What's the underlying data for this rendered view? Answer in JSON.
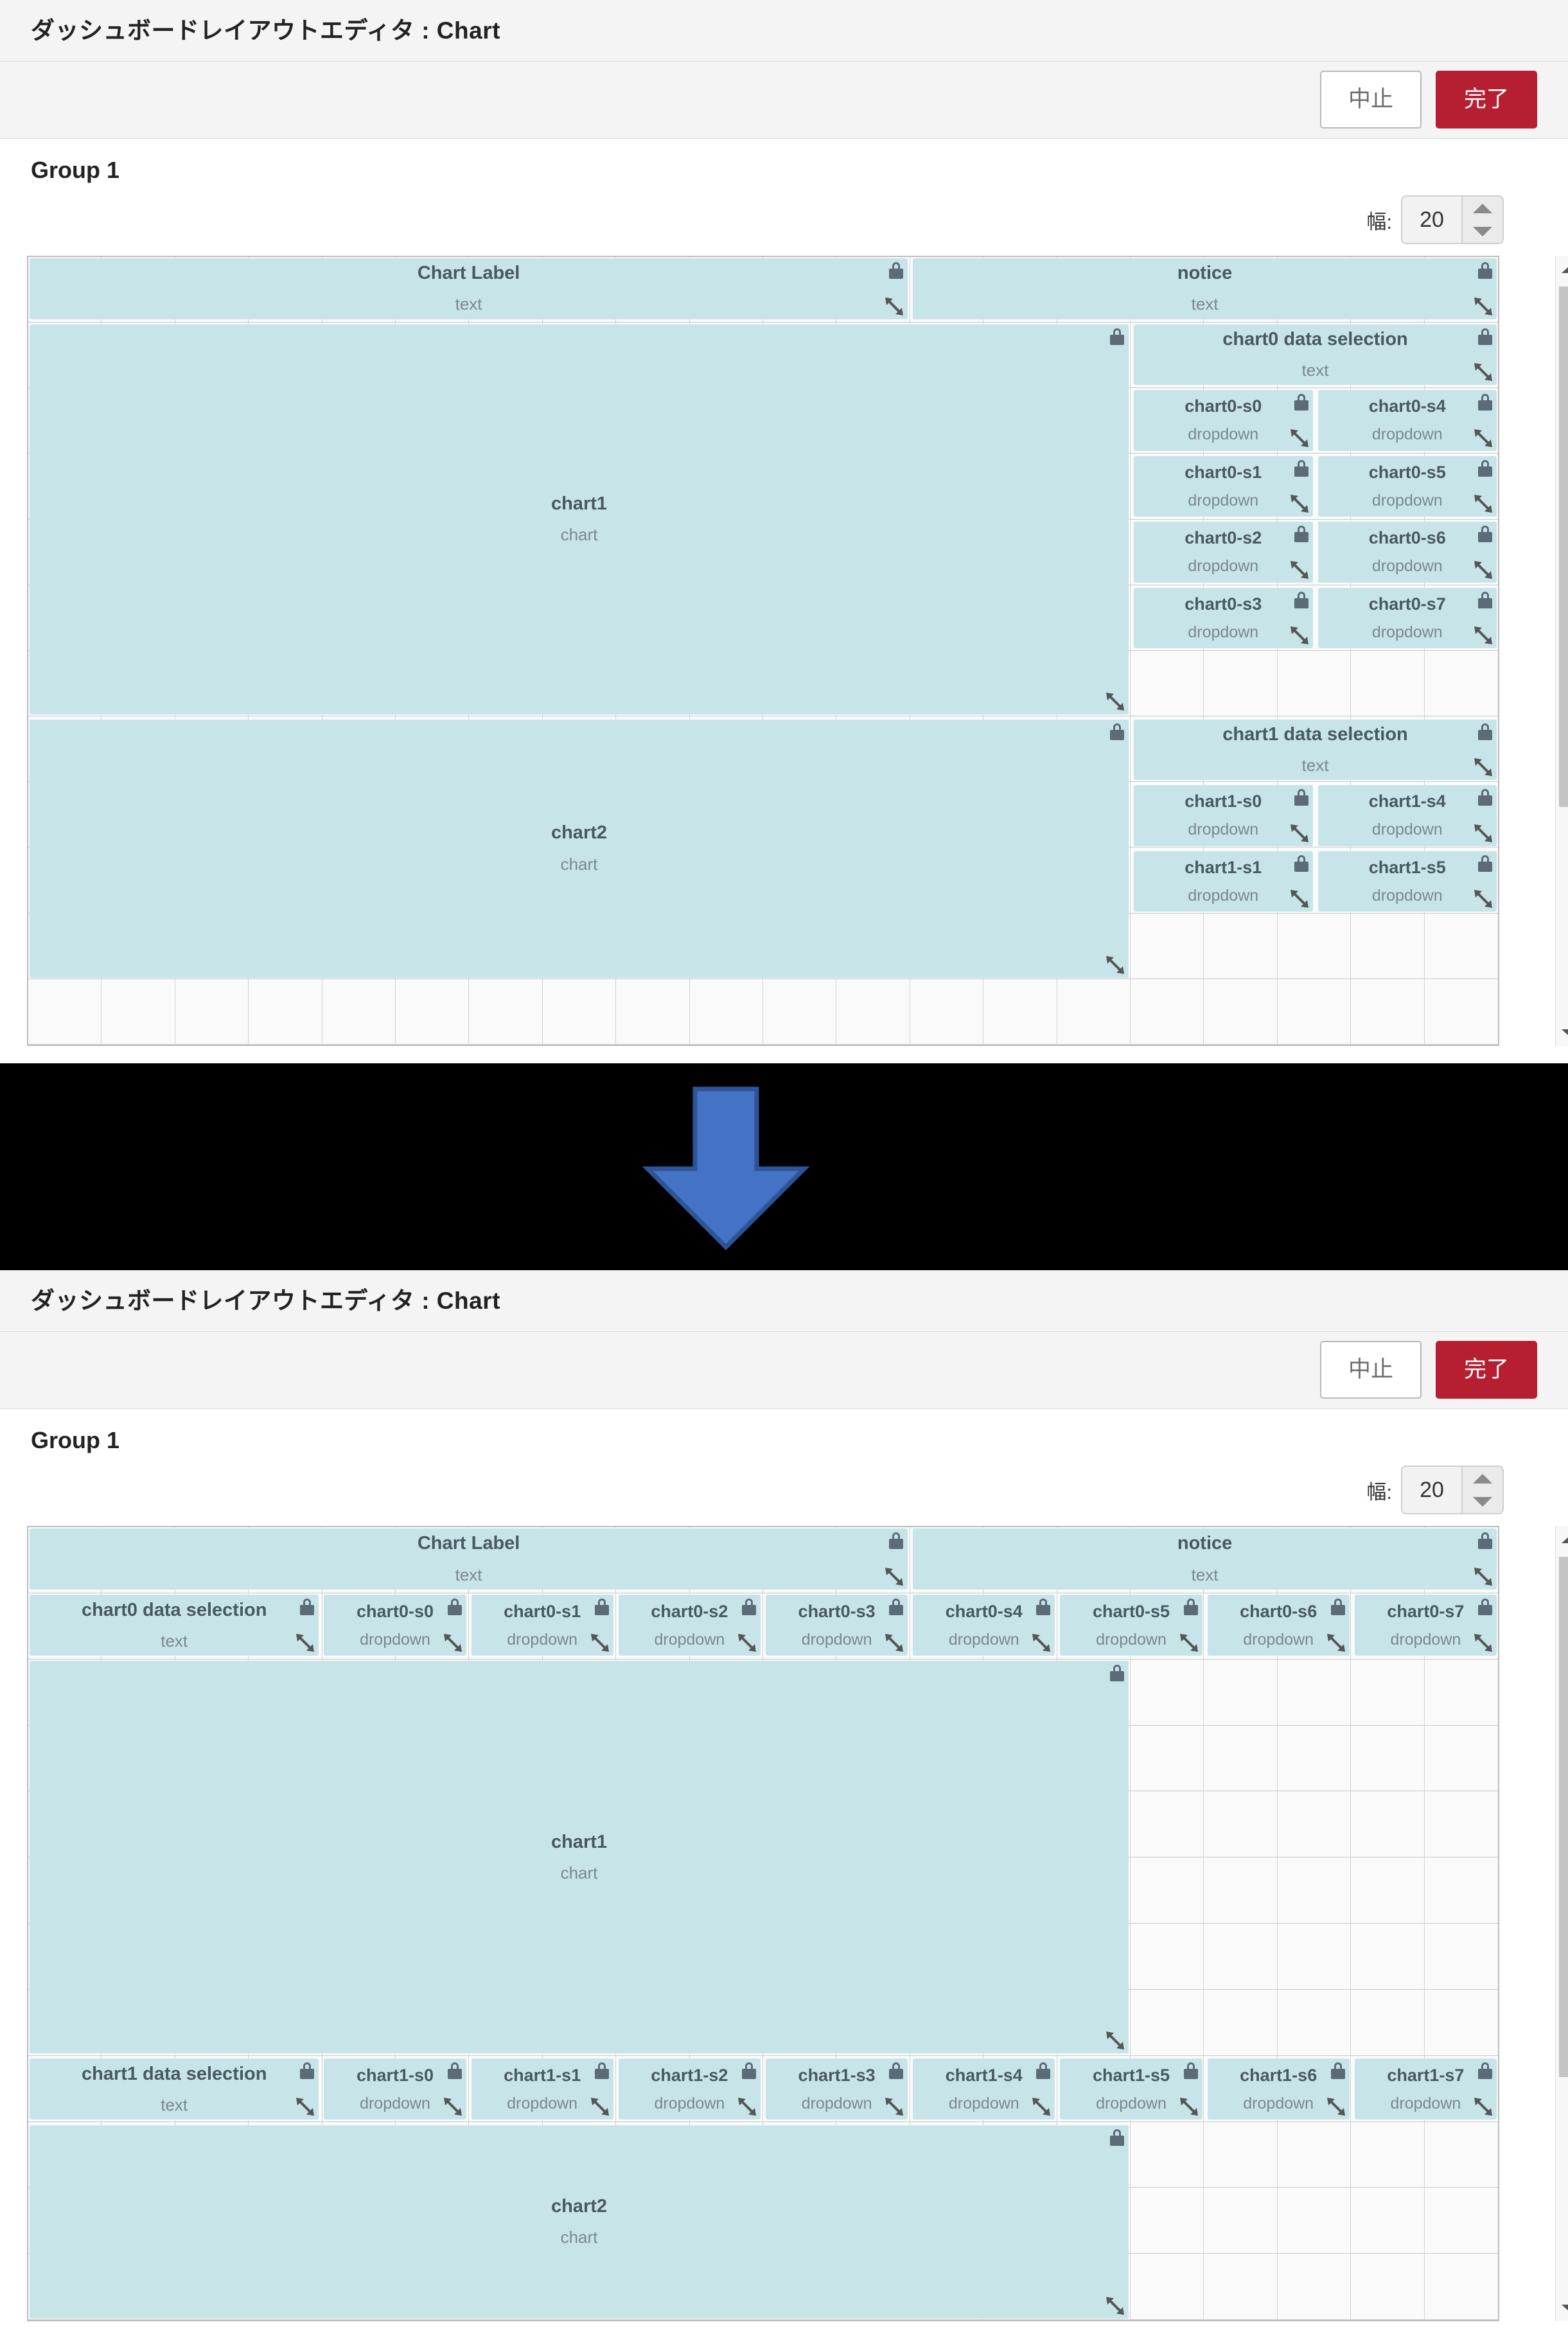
{
  "window": {
    "title": "ダッシュボードレイアウトエディタ : Chart",
    "cancel_label": "中止",
    "done_label": "完了"
  },
  "group": {
    "title": "Group 1"
  },
  "width_control": {
    "label": "幅:",
    "value": "20"
  },
  "colors": {
    "widget_fill": "#c7e5e9",
    "done_button": "#b61f31",
    "arrow": "#4472c4",
    "grid_line": "#d4d4d4"
  },
  "icons": {
    "lock": "lock-icon",
    "resize": "resize-handle-icon",
    "arrow_up": "chevron-up-icon",
    "arrow_down": "chevron-down-icon",
    "transform": "down-arrow-icon"
  },
  "before": {
    "widgets": [
      {
        "title": "Chart Label",
        "type": "text"
      },
      {
        "title": "notice",
        "type": "text"
      },
      {
        "title": "chart1",
        "type": "chart"
      },
      {
        "title": "chart0 data selection",
        "type": "text"
      },
      {
        "title": "chart0-s0",
        "type": "dropdown"
      },
      {
        "title": "chart0-s4",
        "type": "dropdown"
      },
      {
        "title": "chart0-s1",
        "type": "dropdown"
      },
      {
        "title": "chart0-s5",
        "type": "dropdown"
      },
      {
        "title": "chart0-s2",
        "type": "dropdown"
      },
      {
        "title": "chart0-s6",
        "type": "dropdown"
      },
      {
        "title": "chart0-s3",
        "type": "dropdown"
      },
      {
        "title": "chart0-s7",
        "type": "dropdown"
      },
      {
        "title": "chart2",
        "type": "chart"
      },
      {
        "title": "chart1 data selection",
        "type": "text"
      },
      {
        "title": "chart1-s0",
        "type": "dropdown"
      },
      {
        "title": "chart1-s4",
        "type": "dropdown"
      },
      {
        "title": "chart1-s1",
        "type": "dropdown"
      },
      {
        "title": "chart1-s5",
        "type": "dropdown"
      }
    ]
  },
  "after": {
    "widgets": [
      {
        "title": "Chart Label",
        "type": "text"
      },
      {
        "title": "notice",
        "type": "text"
      },
      {
        "title": "chart0 data selection",
        "type": "text"
      },
      {
        "title": "chart0-s0",
        "type": "dropdown"
      },
      {
        "title": "chart0-s1",
        "type": "dropdown"
      },
      {
        "title": "chart0-s2",
        "type": "dropdown"
      },
      {
        "title": "chart0-s3",
        "type": "dropdown"
      },
      {
        "title": "chart0-s4",
        "type": "dropdown"
      },
      {
        "title": "chart0-s5",
        "type": "dropdown"
      },
      {
        "title": "chart0-s6",
        "type": "dropdown"
      },
      {
        "title": "chart0-s7",
        "type": "dropdown"
      },
      {
        "title": "chart1",
        "type": "chart"
      },
      {
        "title": "chart1 data selection",
        "type": "text"
      },
      {
        "title": "chart1-s0",
        "type": "dropdown"
      },
      {
        "title": "chart1-s1",
        "type": "dropdown"
      },
      {
        "title": "chart1-s2",
        "type": "dropdown"
      },
      {
        "title": "chart1-s3",
        "type": "dropdown"
      },
      {
        "title": "chart1-s4",
        "type": "dropdown"
      },
      {
        "title": "chart1-s5",
        "type": "dropdown"
      },
      {
        "title": "chart1-s6",
        "type": "dropdown"
      },
      {
        "title": "chart1-s7",
        "type": "dropdown"
      },
      {
        "title": "chart2",
        "type": "chart"
      }
    ]
  }
}
